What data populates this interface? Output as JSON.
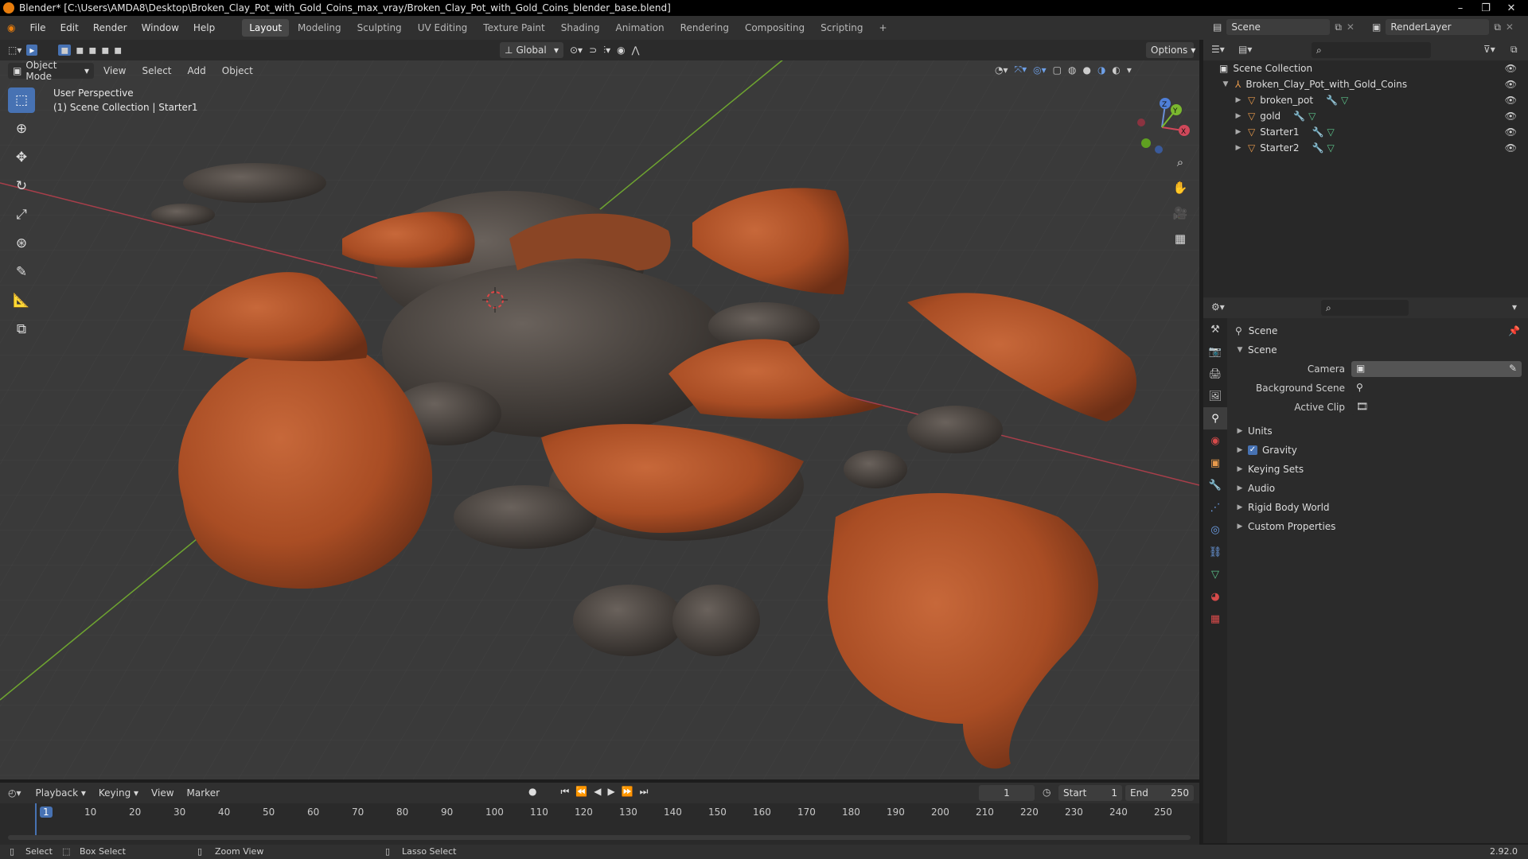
{
  "title": "Blender* [C:\\Users\\AMDA8\\Desktop\\Broken_Clay_Pot_with_Gold_Coins_max_vray/Broken_Clay_Pot_with_Gold_Coins_blender_base.blend]",
  "menu": [
    "File",
    "Edit",
    "Render",
    "Window",
    "Help"
  ],
  "workspaces": [
    "Layout",
    "Modeling",
    "Sculpting",
    "UV Editing",
    "Texture Paint",
    "Shading",
    "Animation",
    "Rendering",
    "Compositing",
    "Scripting"
  ],
  "scene": {
    "name": "Scene",
    "render_layer": "RenderLayer"
  },
  "viewport": {
    "transform_orientation": "Global",
    "options_label": "Options",
    "mode": "Object Mode",
    "menus": [
      "View",
      "Select",
      "Add",
      "Object"
    ],
    "info_line1": "User Perspective",
    "info_line2": "(1) Scene Collection | Starter1",
    "gizmo": {
      "x": "X",
      "y": "Y",
      "z": "Z"
    }
  },
  "outliner": {
    "root": "Scene Collection",
    "collection": "Broken_Clay_Pot_with_Gold_Coins",
    "objects": [
      "broken_pot",
      "gold",
      "Starter1",
      "Starter2"
    ]
  },
  "properties": {
    "header": "Scene",
    "section": "Scene",
    "fields": {
      "camera": "Camera",
      "background_scene": "Background Scene",
      "active_clip": "Active Clip"
    },
    "panels": {
      "units": "Units",
      "gravity": "Gravity",
      "keying_sets": "Keying Sets",
      "audio": "Audio",
      "rigid_body_world": "Rigid Body World",
      "custom_properties": "Custom Properties"
    },
    "gravity_checked": true
  },
  "timeline": {
    "menus": [
      "Playback",
      "Keying",
      "View",
      "Marker"
    ],
    "current_frame": "1",
    "start_label": "Start",
    "start": "1",
    "end_label": "End",
    "end": "250",
    "ruler": [
      "1",
      "10",
      "20",
      "30",
      "40",
      "50",
      "60",
      "70",
      "80",
      "90",
      "100",
      "110",
      "120",
      "130",
      "140",
      "150",
      "160",
      "170",
      "180",
      "190",
      "200",
      "210",
      "220",
      "230",
      "240",
      "250"
    ]
  },
  "status": {
    "select": "Select",
    "box_select": "Box Select",
    "zoom_view": "Zoom View",
    "lasso_select": "Lasso Select",
    "version": "2.92.0"
  },
  "colors": {
    "accent": "#4772b3",
    "clay": "#b4562a",
    "coin": "#4a4440",
    "x_axis": "#c4404f",
    "y_axis": "#7bbf2e"
  }
}
